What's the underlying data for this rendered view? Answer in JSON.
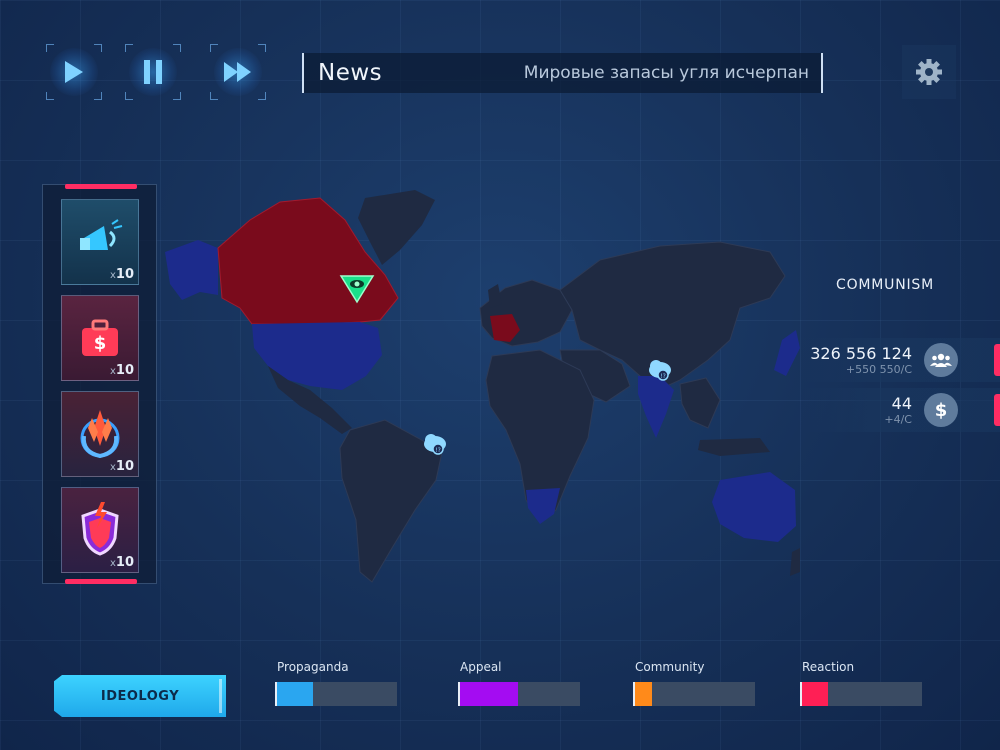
{
  "controls": {
    "play": "play-icon",
    "pause": "pause-icon",
    "fast_forward": "fast-forward-icon",
    "settings": "gear-icon"
  },
  "news": {
    "title": "News",
    "headline": "Мировые запасы угля исчерпан"
  },
  "cards": [
    {
      "icon": "megaphone-icon",
      "prefix": "x",
      "count": "10"
    },
    {
      "icon": "briefcase-dollar-icon",
      "prefix": "x",
      "count": "10"
    },
    {
      "icon": "united-nations-emblem-icon",
      "prefix": "x",
      "count": "10"
    },
    {
      "icon": "lightning-shield-icon",
      "prefix": "x",
      "count": "10"
    }
  ],
  "ideology": {
    "label": "COMMUNISM",
    "button_label": "IDEOLOGY"
  },
  "stats": {
    "followers": {
      "value": "326 556 124",
      "rate": "+550 550/C",
      "icon": "people-icon"
    },
    "money": {
      "value": "44",
      "rate": "+4/C",
      "icon": "dollar-icon",
      "symbol": "$"
    }
  },
  "meters": [
    {
      "label": "Propaganda",
      "level_pct": 30,
      "color": "#2aa6f0"
    },
    {
      "label": "Appeal",
      "level_pct": 48,
      "color": "#a40cf2"
    },
    {
      "label": "Community",
      "level_pct": 14,
      "color": "#ff8a1a"
    },
    {
      "label": "Reaction",
      "level_pct": 22,
      "color": "#ff1f55"
    }
  ],
  "colors": {
    "accent": "#3dd3ff",
    "alert": "#ff2d63",
    "controlled_territory": "#7a0b1c",
    "allied_territory": "#1c2b8c"
  }
}
